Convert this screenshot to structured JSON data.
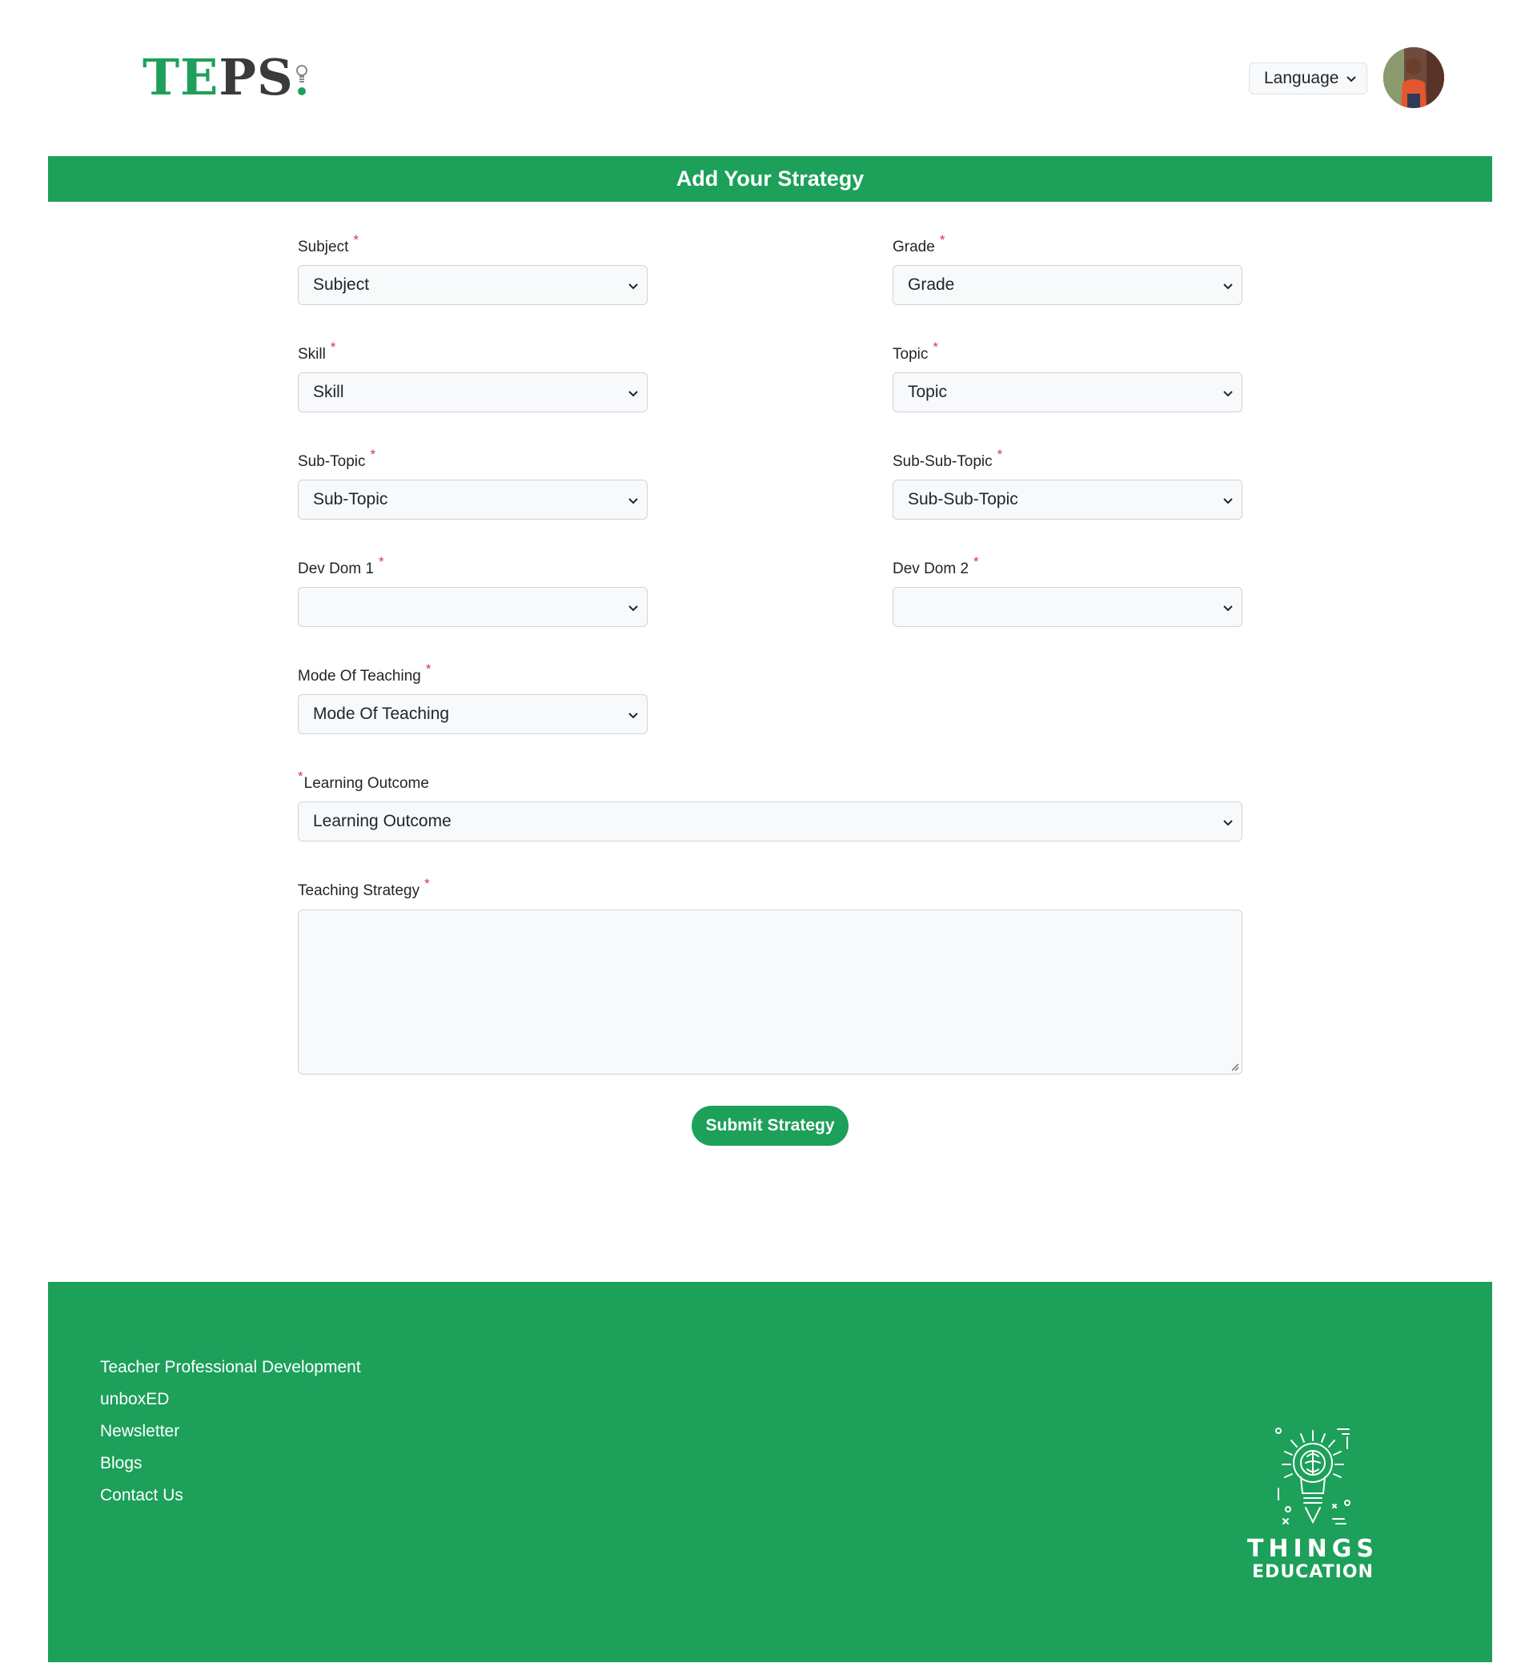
{
  "header": {
    "logo_text": "TEPS",
    "language_select": {
      "selected": "Language"
    },
    "avatar_icon": "user-avatar"
  },
  "page": {
    "title": "Add Your Strategy"
  },
  "form": {
    "subject": {
      "label": "Subject",
      "required_mark": "*",
      "value": "Subject"
    },
    "grade": {
      "label": "Grade",
      "required_mark": "*",
      "value": "Grade"
    },
    "skill": {
      "label": "Skill",
      "required_mark": "*",
      "value": "Skill"
    },
    "topic": {
      "label": "Topic",
      "required_mark": "*",
      "value": "Topic"
    },
    "sub_topic": {
      "label": "Sub-Topic",
      "required_mark": "*",
      "value": "Sub-Topic"
    },
    "sub_sub_topic": {
      "label": "Sub-Sub-Topic",
      "required_mark": "*",
      "value": "Sub-Sub-Topic"
    },
    "dev_dom_1": {
      "label": "Dev Dom 1",
      "required_mark": "*",
      "value": ""
    },
    "dev_dom_2": {
      "label": "Dev Dom 2",
      "required_mark": "*",
      "value": ""
    },
    "mode_of_teaching": {
      "label": "Mode Of Teaching",
      "required_mark": "*",
      "value": "Mode Of Teaching"
    },
    "learning_outcome": {
      "label": "Learning Outcome",
      "required_mark": "*",
      "value": "Learning Outcome"
    },
    "teaching_strategy": {
      "label": "Teaching Strategy",
      "required_mark": "*",
      "value": ""
    },
    "submit_label": "Submit Strategy"
  },
  "footer": {
    "links": [
      "Teacher Professional Development",
      "unboxED",
      "Newsletter",
      "Blogs",
      "Contact Us"
    ],
    "brand_name": "THINGS",
    "brand_sub": "EDUCATION"
  },
  "colors": {
    "brand_green": "#1ca05a",
    "required_red": "#dc3545",
    "logo_dark": "#3a3a3a"
  },
  "icons": {
    "select_arrow": "chevron-down-icon",
    "logo_mark": "lightbulb-icon",
    "footer_logo": "brain-lightbulb-icon"
  }
}
